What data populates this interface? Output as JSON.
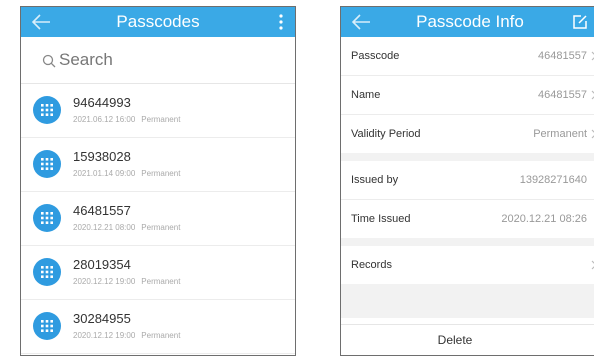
{
  "left_screen": {
    "title": "Passcodes",
    "search": {
      "placeholder": "Search"
    },
    "passcodes": [
      {
        "code": "94644993",
        "date": "2021.06.12 16:00",
        "type": "Permanent"
      },
      {
        "code": "15938028",
        "date": "2021.01.14 09:00",
        "type": "Permanent"
      },
      {
        "code": "46481557",
        "date": "2020.12.21 08:00",
        "type": "Permanent"
      },
      {
        "code": "28019354",
        "date": "2020.12.12 19:00",
        "type": "Permanent"
      },
      {
        "code": "30284955",
        "date": "2020.12.12 19:00",
        "type": "Permanent"
      }
    ]
  },
  "right_screen": {
    "title": "Passcode Info",
    "fields": {
      "passcode": {
        "label": "Passcode",
        "value": "46481557"
      },
      "name": {
        "label": "Name",
        "value": "46481557"
      },
      "validity": {
        "label": "Validity Period",
        "value": "Permanent"
      },
      "issued_by": {
        "label": "Issued by",
        "value": "13928271640"
      },
      "time_issued": {
        "label": "Time Issued",
        "value": "2020.12.21 08:26"
      },
      "records": {
        "label": "Records"
      }
    },
    "delete_label": "Delete"
  },
  "colors": {
    "accent": "#3aa9e6",
    "avatar": "#2f9be0",
    "background_gray": "#f2f2f2"
  },
  "icons": [
    "back-arrow-icon",
    "more-vertical-icon",
    "search-icon",
    "keypad-icon",
    "edit-icon",
    "chevron-right-icon"
  ]
}
